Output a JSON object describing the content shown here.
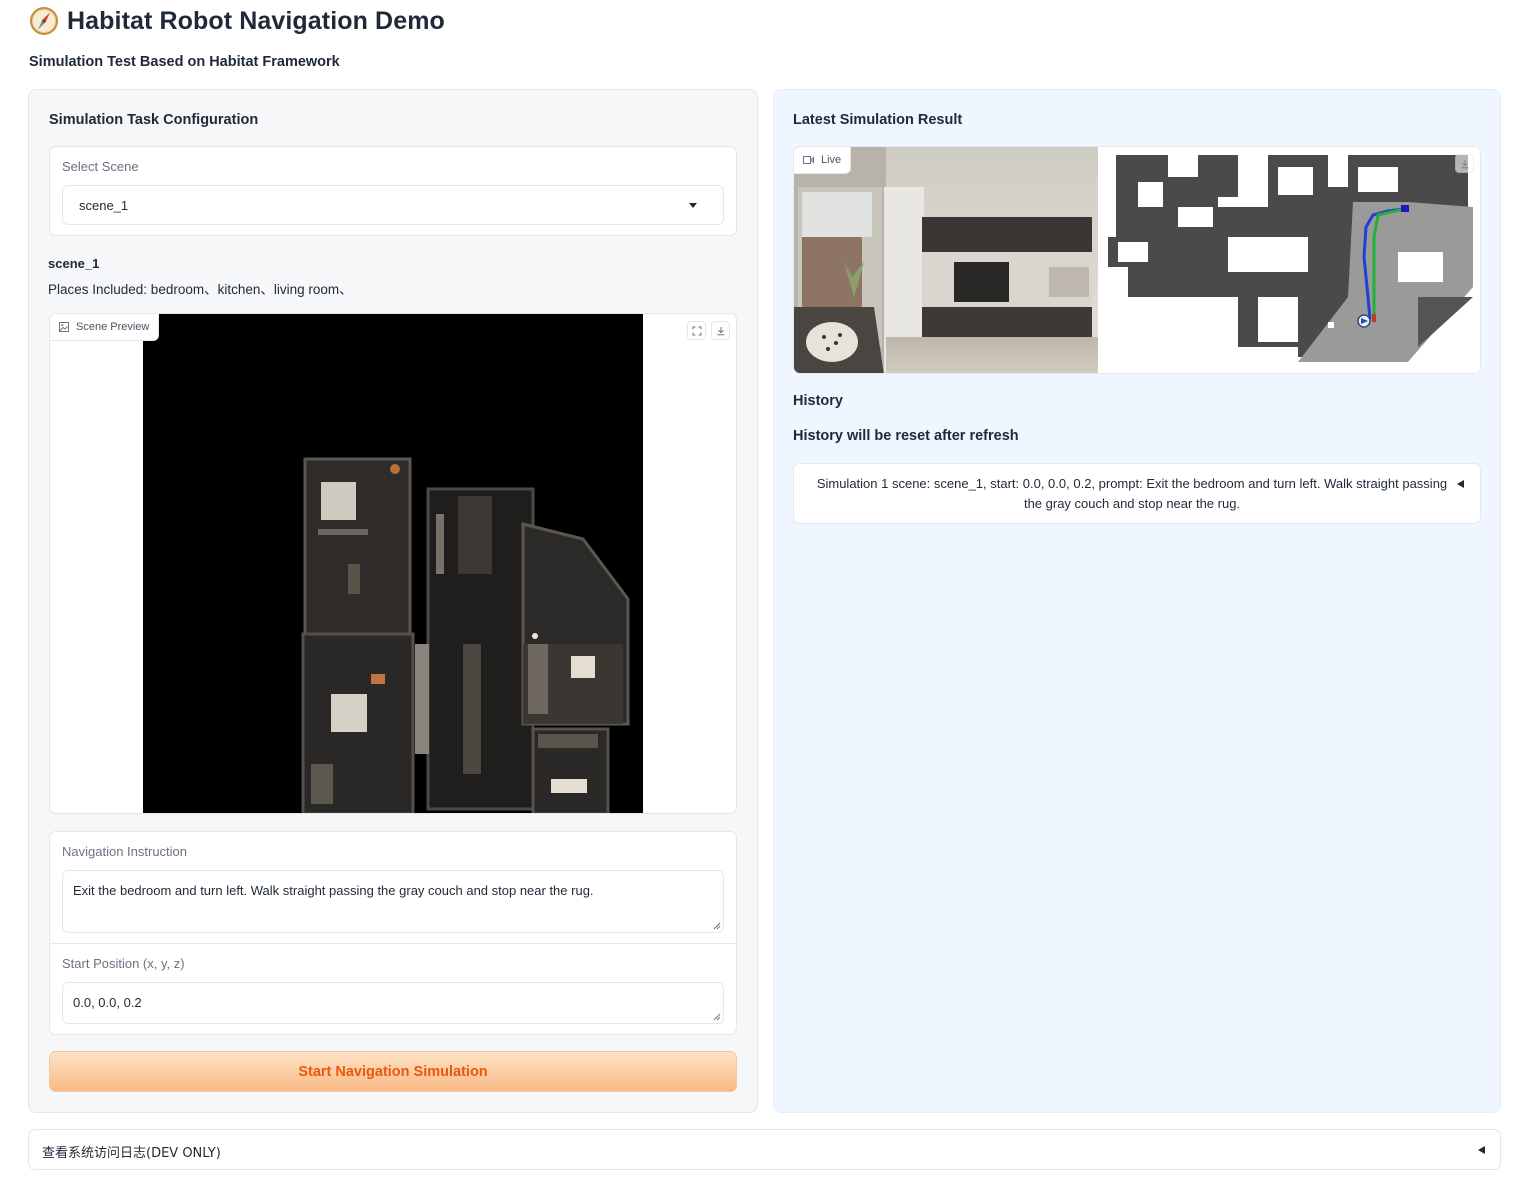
{
  "app": {
    "title": "Habitat Robot Navigation Demo",
    "subtitle": "Simulation Test Based on Habitat Framework"
  },
  "config": {
    "section_title": "Simulation Task Configuration",
    "select_scene": {
      "label": "Select Scene",
      "value": "scene_1"
    },
    "scene_info": {
      "name": "scene_1",
      "places": "Places Included: bedroom、kitchen、living room、"
    },
    "preview": {
      "label": "Scene Preview"
    },
    "instruction": {
      "label": "Navigation Instruction",
      "value": "Exit the bedroom and turn left. Walk straight passing the gray couch and stop near the rug."
    },
    "start_position": {
      "label": "Start Position (x, y, z)",
      "value": "0.0, 0.0, 0.2"
    },
    "start_button": "Start Navigation Simulation"
  },
  "result": {
    "section_title": "Latest Simulation Result",
    "live_label": "Live",
    "history_title": "History",
    "history_note": "History will be reset after refresh",
    "history_items": [
      "Simulation 1 scene: scene_1, start: 0.0, 0.0, 0.2, prompt: Exit the bedroom and turn left. Walk straight passing the gray couch and stop near the rug."
    ]
  },
  "dev_log": {
    "label": "查看系统访问日志(DEV ONLY)"
  },
  "colors": {
    "button_text": "#ea580c",
    "button_gradient_top": "#fde3c6",
    "button_gradient_bottom": "#f9b985",
    "right_panel_bg": "#eff6ff",
    "left_panel_bg": "#f6f7f8"
  },
  "icons": {
    "title": "compass-icon",
    "preview_badge": "image-icon",
    "fullscreen": "fullscreen-icon",
    "download": "download-icon",
    "live": "video-camera-icon",
    "accordion": "triangle-left-icon"
  }
}
